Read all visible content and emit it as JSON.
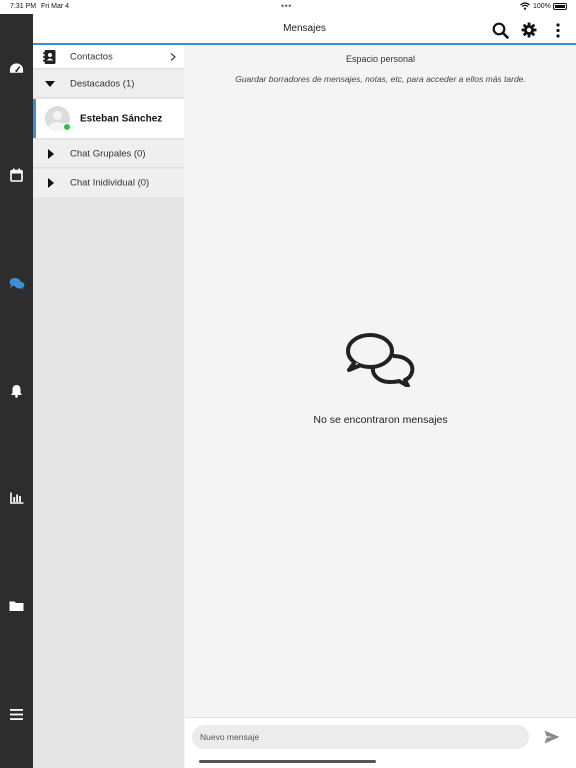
{
  "status_bar": {
    "time": "7:31 PM",
    "date": "Fri Mar 4",
    "dots": "•••",
    "battery": "100%"
  },
  "header": {
    "title": "Mensajes"
  },
  "sidebar": {
    "contacts_label": "Contactos",
    "highlighted_label": "Destacados (1)",
    "user_name": "Esteban Sánchez",
    "user_status": "online",
    "group_chat_label": "Chat Grupales (0)",
    "single_chat_label": "Chat Inidividual (0)"
  },
  "main": {
    "personal_title": "Espacio personal",
    "personal_desc": "Guardar borradores de mensajes, notas, etc, para acceder a ellos más tarde.",
    "empty_text": "No se encontraron mensajes"
  },
  "composer": {
    "placeholder": "Nuevo mensaje"
  },
  "nav_icons": [
    "dashboard-icon",
    "calendar-icon",
    "chat-icon",
    "bell-icon",
    "chart-icon",
    "folder-icon",
    "menu-icon"
  ],
  "colors": {
    "accent": "#3b8fd6",
    "rail": "#2d2d2d",
    "online": "#2ec24a"
  }
}
